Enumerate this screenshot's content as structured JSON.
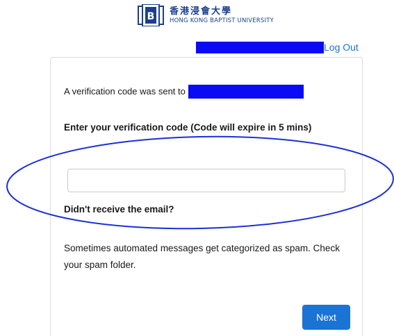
{
  "header": {
    "logo_cn": "香港浸會大學",
    "logo_en": "HONG KONG BAPTIST UNIVERSITY",
    "logout_label": "Log Out"
  },
  "verify": {
    "sent_prefix": "A verification code was sent to",
    "enter_label": "Enter your verification code (Code will expire in 5 mins)",
    "code_value": "",
    "no_email_label": "Didn't receive the email?",
    "spam_text": "Sometimes automated messages get categorized as spam. Check your spam folder.",
    "next_label": "Next"
  },
  "colors": {
    "brand": "#1b3f8f",
    "button": "#1b73d3",
    "link": "#1a73c8",
    "redaction": "#0a0af5",
    "annotation": "#1a2fd6"
  }
}
